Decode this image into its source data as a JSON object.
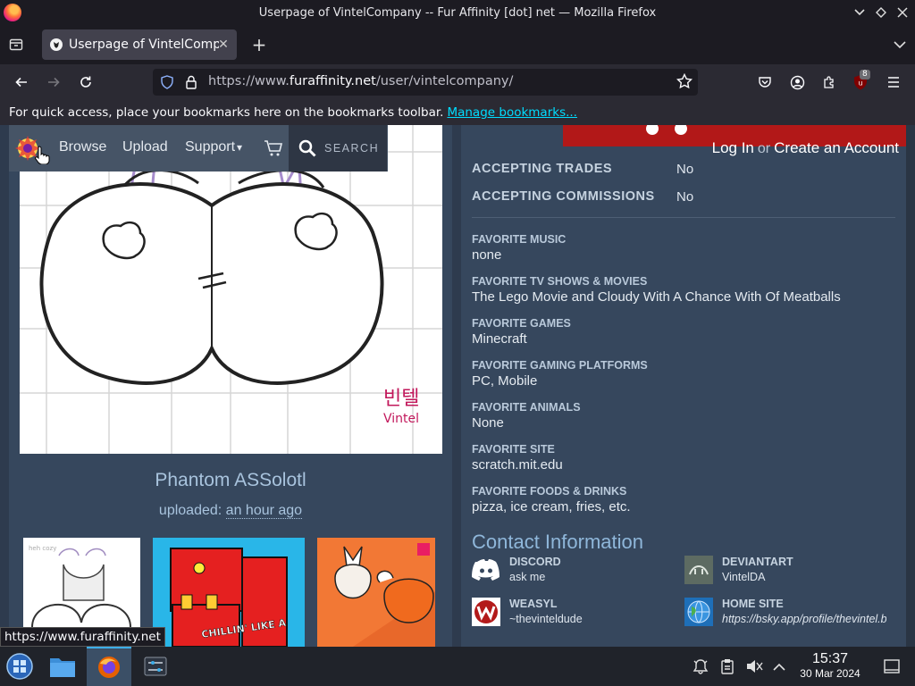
{
  "window": {
    "title": "Userpage of VintelCompany -- Fur Affinity [dot] net — Mozilla Firefox"
  },
  "tabs": [
    {
      "label": "Userpage of VintelCompany -- Fur Affinity [dot] net",
      "active": true
    }
  ],
  "navbar": {
    "url_prefix": "https://www.",
    "url_host": "furaffinity.net",
    "url_path": "/user/vintelcompany/",
    "extension_badge": "8"
  },
  "bookmarks_bar": {
    "message": "For quick access, place your bookmarks here on the bookmarks toolbar.",
    "link": "Manage bookmarks..."
  },
  "site_nav": {
    "items": [
      "Browse",
      "Upload",
      "Support",
      "SEARCH"
    ],
    "support_caret": "▾",
    "login": "Log In",
    "or": "or",
    "create_account": "Create an Account"
  },
  "featured": {
    "title": "Phantom ASSolotl",
    "uploaded_label": "uploaded:",
    "uploaded_time": "an hour ago",
    "signature_korean": "빈텔",
    "signature_latin": "Vintel"
  },
  "thumb_text": {
    "caption": "CHILLIN' LIKE A",
    "corner_note": "heh cozy"
  },
  "stats": [
    {
      "key": "ACCEPTING TRADES",
      "value": "No"
    },
    {
      "key": "ACCEPTING COMMISSIONS",
      "value": "No"
    }
  ],
  "favorites": [
    {
      "key": "FAVORITE MUSIC",
      "value": "none"
    },
    {
      "key": "FAVORITE TV SHOWS & MOVIES",
      "value": "The Lego Movie and Cloudy With A Chance With Of Meatballs"
    },
    {
      "key": "FAVORITE GAMES",
      "value": "Minecraft"
    },
    {
      "key": "FAVORITE GAMING PLATFORMS",
      "value": "PC, Mobile"
    },
    {
      "key": "FAVORITE ANIMALS",
      "value": "None"
    },
    {
      "key": "FAVORITE SITE",
      "value": "scratch.mit.edu"
    },
    {
      "key": "FAVORITE FOODS & DRINKS",
      "value": "pizza, ice cream, fries, etc."
    }
  ],
  "contact": {
    "title": "Contact Information",
    "items": [
      {
        "key": "DISCORD",
        "value": "ask me",
        "icon": "discord-icon"
      },
      {
        "key": "DEVIANTART",
        "value": "VintelDA",
        "icon": "deviantart-icon"
      },
      {
        "key": "WEASYL",
        "value": "~thevinteldude",
        "icon": "weasyl-icon"
      },
      {
        "key": "HOME SITE",
        "value": "https://bsky.app/profile/thevintel.b",
        "icon": "globe-icon"
      }
    ]
  },
  "status_tooltip": "https://www.furaffinity.net",
  "taskbar": {
    "time": "15:37",
    "date": "30 Mar 2024"
  },
  "colors": {
    "page_bg": "#2e3b4e",
    "panel_bg": "#36475d",
    "link_accent": "#00ddff",
    "header_red": "#b21818"
  }
}
